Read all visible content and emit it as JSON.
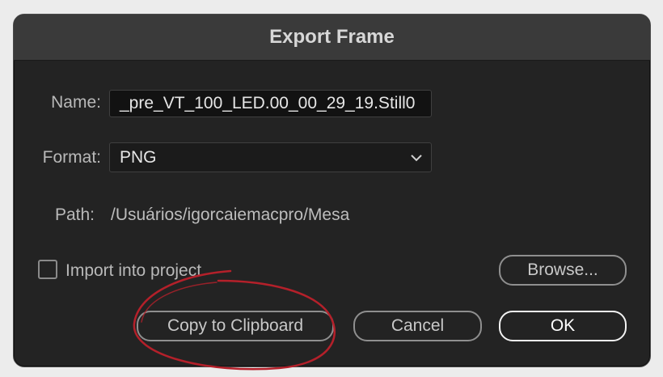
{
  "dialog": {
    "title": "Export Frame",
    "name_label": "Name:",
    "name_value": "_pre_VT_100_LED.00_00_29_19.Still0",
    "format_label": "Format:",
    "format_value": "PNG",
    "path_label": "Path:",
    "path_value": "/Usuários/igorcaiemacpro/Mesa",
    "import_label": "Import into project",
    "import_checked": false,
    "browse_label": "Browse...",
    "copy_label": "Copy to Clipboard",
    "cancel_label": "Cancel",
    "ok_label": "OK"
  },
  "icons": {
    "format_dropdown": "chevron-down-icon"
  },
  "colors": {
    "annotation": "#b4202a",
    "dialog_bg": "#232323",
    "title_bar": "#3a3a3a"
  }
}
